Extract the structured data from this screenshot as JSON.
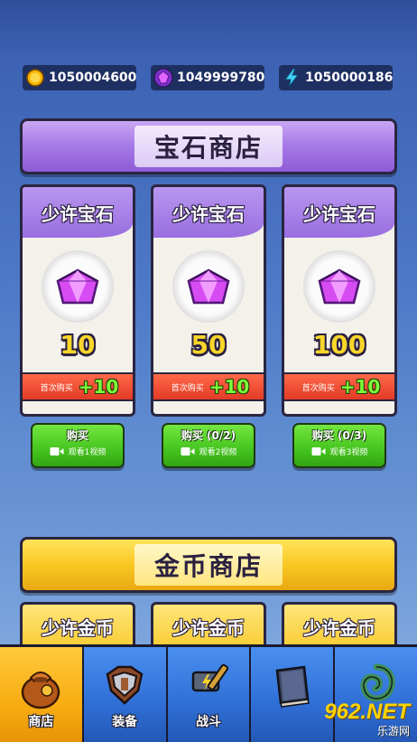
{
  "currencies": {
    "gold": {
      "icon": "gold-coin-icon",
      "value": "1050004600"
    },
    "gem": {
      "icon": "purple-gem-icon",
      "value": "1049999780"
    },
    "energy": {
      "icon": "lightning-icon",
      "value": "1050000186"
    }
  },
  "gem_shop": {
    "title": "宝石商店",
    "cards": [
      {
        "name": "少许宝石",
        "amount": "10",
        "bonus_label": "首次购买",
        "bonus": "+10",
        "buy_label": "购买",
        "watch_label": "观看1视频"
      },
      {
        "name": "少许宝石",
        "amount": "50",
        "bonus_label": "首次购买",
        "bonus": "+10",
        "buy_label": "购买  (0/2)",
        "watch_label": "观看2视频"
      },
      {
        "name": "少许宝石",
        "amount": "100",
        "bonus_label": "首次购买",
        "bonus": "+10",
        "buy_label": "购买  (0/3)",
        "watch_label": "观看3视频"
      }
    ]
  },
  "gold_shop": {
    "title": "金币商店",
    "cards": [
      {
        "name": "少许金币"
      },
      {
        "name": "少许金币"
      },
      {
        "name": "少许金币"
      }
    ]
  },
  "nav": {
    "items": [
      {
        "label": "商店",
        "icon": "bag-icon",
        "active": true
      },
      {
        "label": "装备",
        "icon": "armor-icon",
        "active": false
      },
      {
        "label": "战斗",
        "icon": "hammer-icon",
        "active": false
      },
      {
        "label": "",
        "icon": "book-icon",
        "active": false
      },
      {
        "label": "",
        "icon": "dragon-icon",
        "active": false
      }
    ]
  },
  "watermark": {
    "brand": "962.NET",
    "sub": "乐游网"
  },
  "colors": {
    "gem_purple": "#a97ce8",
    "gold_yellow": "#f9c824",
    "buy_green": "#45c41f",
    "bonus_red": "#e23a25",
    "nav_blue": "#2f6fd6",
    "nav_active": "#f8ad12"
  }
}
